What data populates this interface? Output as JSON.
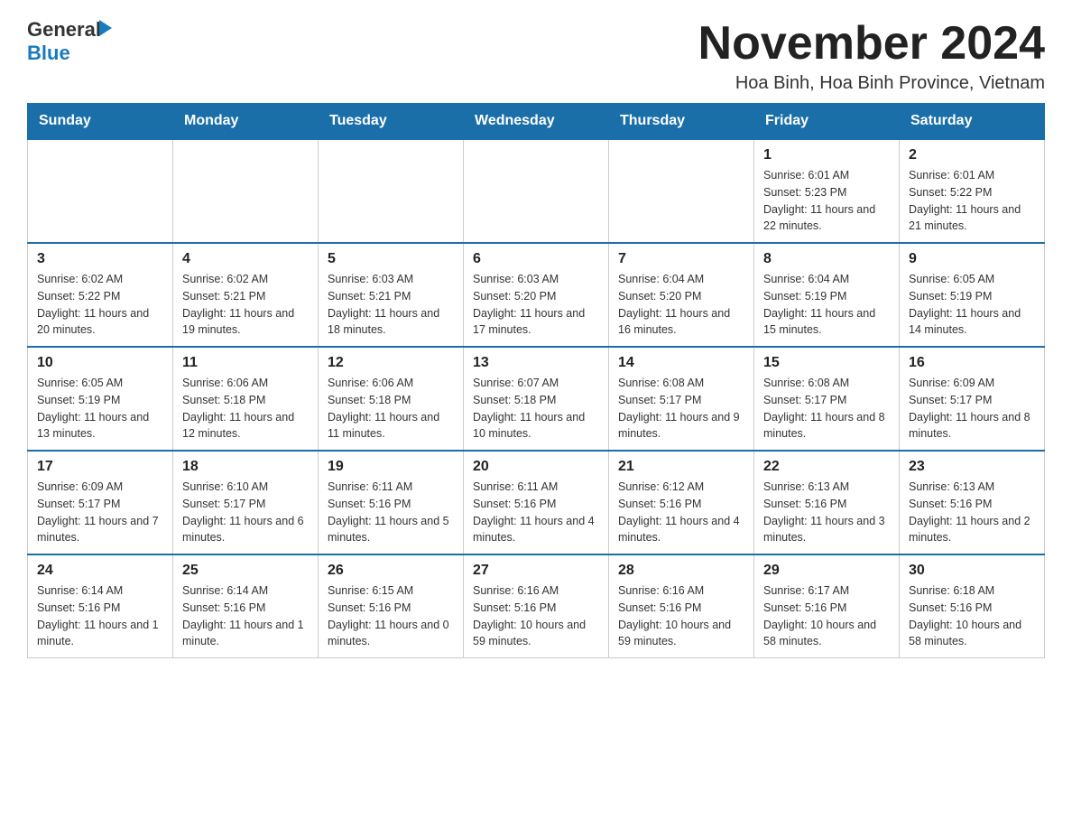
{
  "header": {
    "logo_general": "General",
    "logo_blue": "Blue",
    "main_title": "November 2024",
    "subtitle": "Hoa Binh, Hoa Binh Province, Vietnam"
  },
  "weekdays": [
    "Sunday",
    "Monday",
    "Tuesday",
    "Wednesday",
    "Thursday",
    "Friday",
    "Saturday"
  ],
  "weeks": [
    [
      {
        "day": "",
        "info": ""
      },
      {
        "day": "",
        "info": ""
      },
      {
        "day": "",
        "info": ""
      },
      {
        "day": "",
        "info": ""
      },
      {
        "day": "",
        "info": ""
      },
      {
        "day": "1",
        "info": "Sunrise: 6:01 AM\nSunset: 5:23 PM\nDaylight: 11 hours and 22 minutes."
      },
      {
        "day": "2",
        "info": "Sunrise: 6:01 AM\nSunset: 5:22 PM\nDaylight: 11 hours and 21 minutes."
      }
    ],
    [
      {
        "day": "3",
        "info": "Sunrise: 6:02 AM\nSunset: 5:22 PM\nDaylight: 11 hours and 20 minutes."
      },
      {
        "day": "4",
        "info": "Sunrise: 6:02 AM\nSunset: 5:21 PM\nDaylight: 11 hours and 19 minutes."
      },
      {
        "day": "5",
        "info": "Sunrise: 6:03 AM\nSunset: 5:21 PM\nDaylight: 11 hours and 18 minutes."
      },
      {
        "day": "6",
        "info": "Sunrise: 6:03 AM\nSunset: 5:20 PM\nDaylight: 11 hours and 17 minutes."
      },
      {
        "day": "7",
        "info": "Sunrise: 6:04 AM\nSunset: 5:20 PM\nDaylight: 11 hours and 16 minutes."
      },
      {
        "day": "8",
        "info": "Sunrise: 6:04 AM\nSunset: 5:19 PM\nDaylight: 11 hours and 15 minutes."
      },
      {
        "day": "9",
        "info": "Sunrise: 6:05 AM\nSunset: 5:19 PM\nDaylight: 11 hours and 14 minutes."
      }
    ],
    [
      {
        "day": "10",
        "info": "Sunrise: 6:05 AM\nSunset: 5:19 PM\nDaylight: 11 hours and 13 minutes."
      },
      {
        "day": "11",
        "info": "Sunrise: 6:06 AM\nSunset: 5:18 PM\nDaylight: 11 hours and 12 minutes."
      },
      {
        "day": "12",
        "info": "Sunrise: 6:06 AM\nSunset: 5:18 PM\nDaylight: 11 hours and 11 minutes."
      },
      {
        "day": "13",
        "info": "Sunrise: 6:07 AM\nSunset: 5:18 PM\nDaylight: 11 hours and 10 minutes."
      },
      {
        "day": "14",
        "info": "Sunrise: 6:08 AM\nSunset: 5:17 PM\nDaylight: 11 hours and 9 minutes."
      },
      {
        "day": "15",
        "info": "Sunrise: 6:08 AM\nSunset: 5:17 PM\nDaylight: 11 hours and 8 minutes."
      },
      {
        "day": "16",
        "info": "Sunrise: 6:09 AM\nSunset: 5:17 PM\nDaylight: 11 hours and 8 minutes."
      }
    ],
    [
      {
        "day": "17",
        "info": "Sunrise: 6:09 AM\nSunset: 5:17 PM\nDaylight: 11 hours and 7 minutes."
      },
      {
        "day": "18",
        "info": "Sunrise: 6:10 AM\nSunset: 5:17 PM\nDaylight: 11 hours and 6 minutes."
      },
      {
        "day": "19",
        "info": "Sunrise: 6:11 AM\nSunset: 5:16 PM\nDaylight: 11 hours and 5 minutes."
      },
      {
        "day": "20",
        "info": "Sunrise: 6:11 AM\nSunset: 5:16 PM\nDaylight: 11 hours and 4 minutes."
      },
      {
        "day": "21",
        "info": "Sunrise: 6:12 AM\nSunset: 5:16 PM\nDaylight: 11 hours and 4 minutes."
      },
      {
        "day": "22",
        "info": "Sunrise: 6:13 AM\nSunset: 5:16 PM\nDaylight: 11 hours and 3 minutes."
      },
      {
        "day": "23",
        "info": "Sunrise: 6:13 AM\nSunset: 5:16 PM\nDaylight: 11 hours and 2 minutes."
      }
    ],
    [
      {
        "day": "24",
        "info": "Sunrise: 6:14 AM\nSunset: 5:16 PM\nDaylight: 11 hours and 1 minute."
      },
      {
        "day": "25",
        "info": "Sunrise: 6:14 AM\nSunset: 5:16 PM\nDaylight: 11 hours and 1 minute."
      },
      {
        "day": "26",
        "info": "Sunrise: 6:15 AM\nSunset: 5:16 PM\nDaylight: 11 hours and 0 minutes."
      },
      {
        "day": "27",
        "info": "Sunrise: 6:16 AM\nSunset: 5:16 PM\nDaylight: 10 hours and 59 minutes."
      },
      {
        "day": "28",
        "info": "Sunrise: 6:16 AM\nSunset: 5:16 PM\nDaylight: 10 hours and 59 minutes."
      },
      {
        "day": "29",
        "info": "Sunrise: 6:17 AM\nSunset: 5:16 PM\nDaylight: 10 hours and 58 minutes."
      },
      {
        "day": "30",
        "info": "Sunrise: 6:18 AM\nSunset: 5:16 PM\nDaylight: 10 hours and 58 minutes."
      }
    ]
  ]
}
